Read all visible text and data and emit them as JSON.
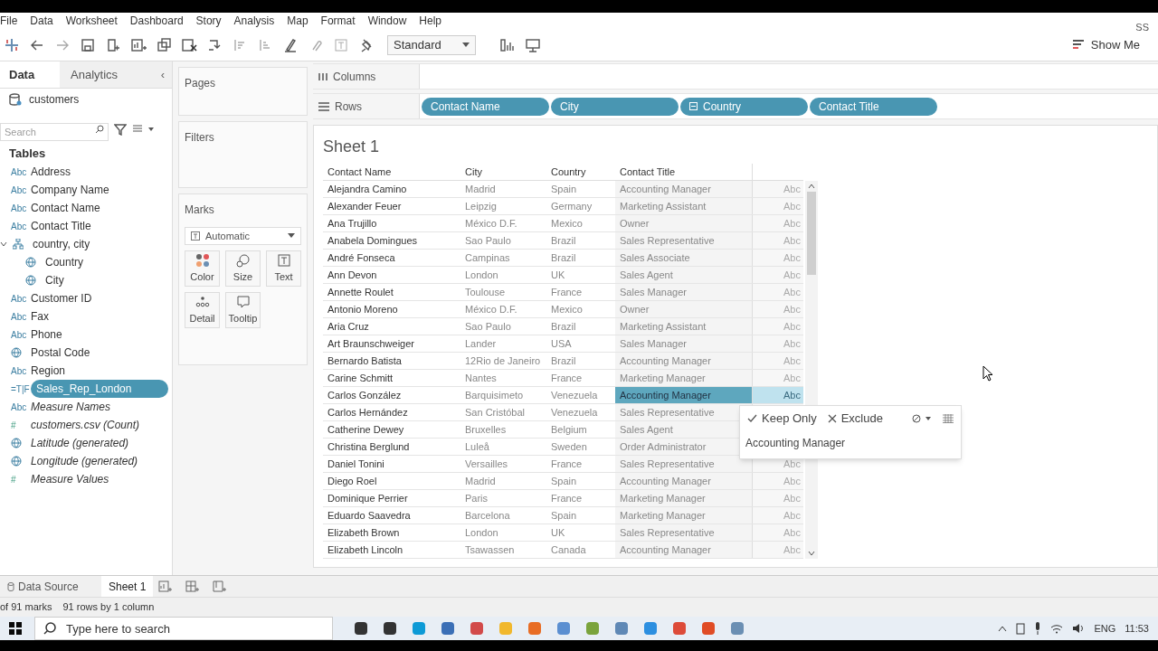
{
  "menu": [
    "File",
    "Data",
    "Worksheet",
    "Dashboard",
    "Story",
    "Analysis",
    "Map",
    "Format",
    "Window",
    "Help"
  ],
  "user_initials": "SS",
  "toolbar": {
    "mark_size": "Standard",
    "show_me": "Show Me"
  },
  "data_pane": {
    "tabs": [
      {
        "label": "Data",
        "selected": true
      },
      {
        "label": "Analytics",
        "selected": false
      }
    ],
    "collapse": "‹",
    "datasource": "customers",
    "search": {
      "placeholder": "Search"
    },
    "heading": "Tables",
    "fields": [
      {
        "kind": "abc",
        "icon_text": "Abc",
        "name": "Address",
        "selected": false,
        "italic": false
      },
      {
        "kind": "abc",
        "icon_text": "Abc",
        "name": "Company Name",
        "selected": false,
        "italic": false
      },
      {
        "kind": "abc",
        "icon_text": "Abc",
        "name": "Contact Name",
        "selected": false,
        "italic": false
      },
      {
        "kind": "abc",
        "icon_text": "Abc",
        "name": "Contact Title",
        "selected": false,
        "italic": false
      },
      {
        "kind": "hierarchy",
        "name": "country, city",
        "selected": false,
        "italic": false,
        "expanded": true,
        "children": [
          {
            "kind": "geo",
            "name": "Country",
            "selected": false,
            "italic": false
          },
          {
            "kind": "geo",
            "name": "City",
            "selected": false,
            "italic": false
          }
        ]
      },
      {
        "kind": "abc",
        "icon_text": "Abc",
        "name": "Customer ID",
        "selected": false,
        "italic": false
      },
      {
        "kind": "abc",
        "icon_text": "Abc",
        "name": "Fax",
        "selected": false,
        "italic": false
      },
      {
        "kind": "abc",
        "icon_text": "Abc",
        "name": "Phone",
        "selected": false,
        "italic": false
      },
      {
        "kind": "geo",
        "name": "Postal Code",
        "selected": false,
        "italic": false
      },
      {
        "kind": "abc",
        "icon_text": "Abc",
        "name": "Region",
        "selected": false,
        "italic": false
      },
      {
        "kind": "calc",
        "icon_text": "=T|F",
        "name": "Sales_Rep_London",
        "selected": true,
        "italic": false
      },
      {
        "kind": "abc",
        "icon_text": "Abc",
        "name": "Measure Names",
        "selected": false,
        "italic": true
      },
      {
        "kind": "measure",
        "icon_text": "#",
        "name": "customers.csv (Count)",
        "selected": false,
        "italic": true
      },
      {
        "kind": "geo",
        "name": "Latitude (generated)",
        "selected": false,
        "italic": true
      },
      {
        "kind": "geo",
        "name": "Longitude (generated)",
        "selected": false,
        "italic": true
      },
      {
        "kind": "measure",
        "icon_text": "#",
        "name": "Measure Values",
        "selected": false,
        "italic": true
      }
    ]
  },
  "cards": {
    "pages": "Pages",
    "filters": "Filters",
    "marks": {
      "title": "Marks",
      "mark_type": "Automatic",
      "buttons": [
        {
          "kind": "color",
          "label": "Color"
        },
        {
          "kind": "size",
          "label": "Size"
        },
        {
          "kind": "text",
          "label": "Text"
        },
        {
          "kind": "detail",
          "label": "Detail"
        },
        {
          "kind": "tooltip",
          "label": "Tooltip"
        }
      ]
    }
  },
  "shelves": {
    "columns": {
      "label": "Columns"
    },
    "rows": {
      "label": "Rows",
      "pills": [
        {
          "label": "Contact Name",
          "hierarchy": false
        },
        {
          "label": "City",
          "hierarchy": false
        },
        {
          "label": "Country",
          "hierarchy": true
        },
        {
          "label": "Contact Title",
          "hierarchy": false
        }
      ]
    }
  },
  "sheet": {
    "title": "Sheet 1",
    "table": {
      "columns": [
        "Contact Name",
        "City",
        "Country",
        "Contact Title"
      ],
      "rows": [
        {
          "cells": [
            "Alejandra Camino",
            "Madrid",
            "Spain",
            "Accounting Manager"
          ],
          "mark": "Abc",
          "selected": false
        },
        {
          "cells": [
            "Alexander Feuer",
            "Leipzig",
            "Germany",
            "Marketing Assistant"
          ],
          "mark": "Abc",
          "selected": false
        },
        {
          "cells": [
            "Ana Trujillo",
            "México D.F.",
            "Mexico",
            "Owner"
          ],
          "mark": "Abc",
          "selected": false
        },
        {
          "cells": [
            "Anabela Domingues",
            "Sao Paulo",
            "Brazil",
            "Sales Representative"
          ],
          "mark": "Abc",
          "selected": false
        },
        {
          "cells": [
            "André Fonseca",
            "Campinas",
            "Brazil",
            "Sales Associate"
          ],
          "mark": "Abc",
          "selected": false
        },
        {
          "cells": [
            "Ann Devon",
            "London",
            "UK",
            "Sales Agent"
          ],
          "mark": "Abc",
          "selected": false
        },
        {
          "cells": [
            "Annette Roulet",
            "Toulouse",
            "France",
            "Sales Manager"
          ],
          "mark": "Abc",
          "selected": false
        },
        {
          "cells": [
            "Antonio Moreno",
            "México D.F.",
            "Mexico",
            "Owner"
          ],
          "mark": "Abc",
          "selected": false
        },
        {
          "cells": [
            "Aria Cruz",
            "Sao Paulo",
            "Brazil",
            "Marketing Assistant"
          ],
          "mark": "Abc",
          "selected": false
        },
        {
          "cells": [
            "Art Braunschweiger",
            "Lander",
            "USA",
            "Sales Manager"
          ],
          "mark": "Abc",
          "selected": false
        },
        {
          "cells": [
            "Bernardo Batista",
            "12Rio de Janeiro",
            "Brazil",
            "Accounting Manager"
          ],
          "mark": "Abc",
          "selected": false
        },
        {
          "cells": [
            "Carine Schmitt",
            "Nantes",
            "France",
            "Marketing Manager"
          ],
          "mark": "Abc",
          "selected": false
        },
        {
          "cells": [
            "Carlos González",
            "Barquisimeto",
            "Venezuela",
            "Accounting Manager"
          ],
          "mark": "Abc",
          "selected": true
        },
        {
          "cells": [
            "Carlos Hernández",
            "San Cristóbal",
            "Venezuela",
            "Sales Representative"
          ],
          "selected": false
        },
        {
          "cells": [
            "Catherine Dewey",
            "Bruxelles",
            "Belgium",
            "Sales Agent"
          ],
          "selected": false
        },
        {
          "cells": [
            "Christina Berglund",
            "Luleå",
            "Sweden",
            "Order Administrator"
          ],
          "selected": false
        },
        {
          "cells": [
            "Daniel Tonini",
            "Versailles",
            "France",
            "Sales Representative"
          ],
          "mark": "Abc",
          "selected": false
        },
        {
          "cells": [
            "Diego Roel",
            "Madrid",
            "Spain",
            "Accounting Manager"
          ],
          "mark": "Abc",
          "selected": false
        },
        {
          "cells": [
            "Dominique Perrier",
            "Paris",
            "France",
            "Marketing Manager"
          ],
          "mark": "Abc",
          "selected": false
        },
        {
          "cells": [
            "Eduardo Saavedra",
            "Barcelona",
            "Spain",
            "Marketing Manager"
          ],
          "mark": "Abc",
          "selected": false
        },
        {
          "cells": [
            "Elizabeth Brown",
            "London",
            "UK",
            "Sales Representative"
          ],
          "mark": "Abc",
          "selected": false
        },
        {
          "cells": [
            "Elizabeth Lincoln",
            "Tsawassen",
            "Canada",
            "Accounting Manager"
          ],
          "mark": "Abc",
          "selected": false
        }
      ]
    },
    "tooltip": {
      "keep_only": "Keep Only",
      "exclude": "Exclude",
      "value": "Accounting Manager"
    }
  },
  "sheet_tabs": [
    {
      "label": "Data Source",
      "kind": "datasource",
      "selected": false
    },
    {
      "label": "Sheet 1",
      "kind": "sheet",
      "selected": true
    }
  ],
  "status_bar": [
    "of 91 marks",
    "91 rows by 1 column"
  ],
  "taskbar": {
    "search_placeholder": "Type here to search",
    "language": "ENG",
    "time": "11:53"
  }
}
